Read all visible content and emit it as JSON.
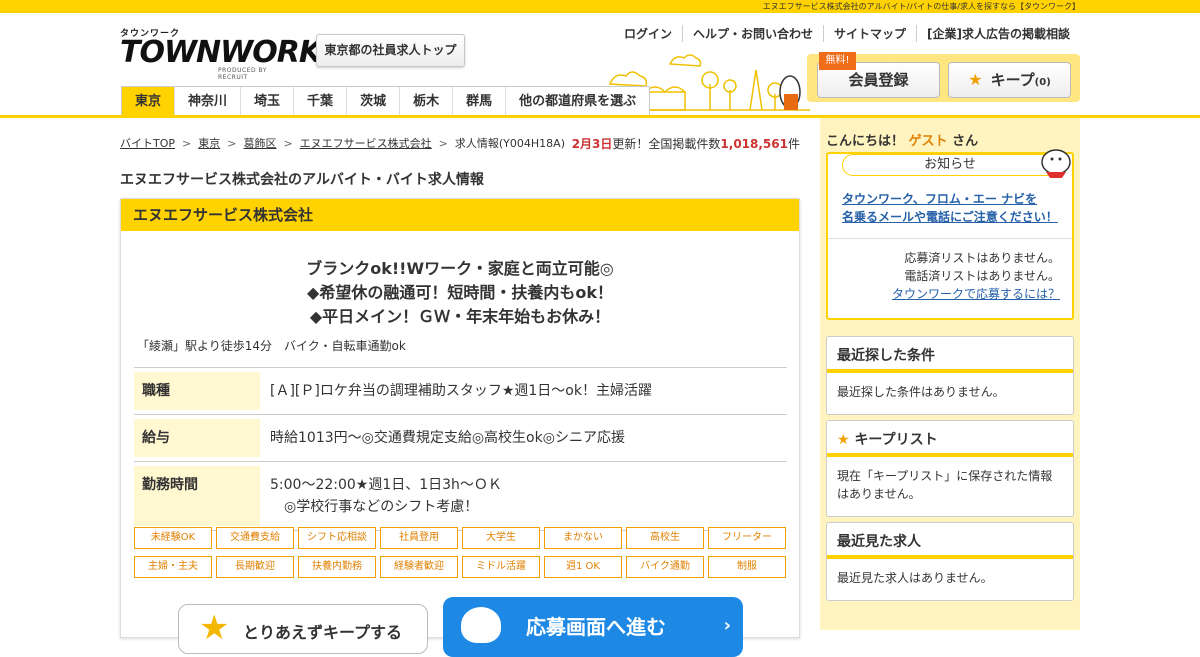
{
  "topbar": {
    "text": "エヌエフサービス株式会社のアルバイト/バイトの仕事/求人を探すなら【タウンワーク】"
  },
  "logo": {
    "kana": "タウンワーク",
    "word": "TOWNWORK",
    "produced": "PRODUCED BY RECRUIT"
  },
  "header": {
    "region_top": "東京都の社員求人トップ",
    "links": [
      "ログイン",
      "ヘルプ・お問い合わせ",
      "サイトマップ",
      "[企業]求人広告の掲載相談"
    ],
    "free_badge": "無料!",
    "register": "会員登録",
    "keep": "キープ",
    "keep_count": "(0)"
  },
  "prefectures": [
    "東京",
    "神奈川",
    "埼玉",
    "千葉",
    "茨城",
    "栃木",
    "群馬",
    "他の都道府県を選ぶ"
  ],
  "breadcrumb": [
    "バイトTOP",
    "東京",
    "葛飾区",
    "エヌエフサービス株式会社",
    "求人情報(Y004H18A)"
  ],
  "update": {
    "date": "2月3日",
    "mid": "更新！全国掲載件数",
    "count": "1,018,561",
    "unit": "件"
  },
  "page_title": "エヌエフサービス株式会社のアルバイト・バイト求人情報",
  "job": {
    "company": "エヌエフサービス株式会社",
    "catch": [
      "ブランクok!!Wワーク・家庭と両立可能◎",
      "◆希望休の融通可！短時間・扶養内もok！",
      "◆平日メイン！ＧＷ・年末年始もお休み！"
    ],
    "station": "「綾瀬」駅より徒歩14分　バイク・自転車通勤ok",
    "rows": [
      {
        "key": "職種",
        "value": "[Ａ][Ｐ]ロケ弁当の調理補助スタッフ★週1日～ok！主婦活躍"
      },
      {
        "key": "給与",
        "value": "時給1013円～◎交通費規定支給◎高校生ok◎シニア応援"
      },
      {
        "key": "勤務時間",
        "value": "5:00～22:00★週1日、1日3h～ＯＫ",
        "value2": "◎学校行事などのシフト考慮！"
      }
    ],
    "tags": [
      "未経験OK",
      "交通費支給",
      "シフト応相談",
      "社員登用",
      "大学生",
      "まかない",
      "高校生",
      "フリーター",
      "主婦・主夫",
      "長期歓迎",
      "扶養内勤務",
      "経験者歓迎",
      "ミドル活躍",
      "週1 OK",
      "バイク通勤",
      "制服"
    ],
    "keep_button": "とりあえずキープする",
    "apply_button": "応募画面へ進む"
  },
  "sidebar": {
    "greet_prefix": "こんにちは！",
    "guest": "ゲスト",
    "greet_suffix": "さん",
    "notice_title": "お知らせ",
    "notice_link_1": "タウンワーク、フロム・エー ナビを",
    "notice_link_2": "名乗るメールや電話にご注意ください！",
    "applied_list": "応募済リストはありません。",
    "called_list": "電話済リストはありません。",
    "howto": "タウンワークで応募するには？",
    "recent_search_title": "最近探した条件",
    "recent_search_body": "最近探した条件はありません。",
    "keep_list_title": "キープリスト",
    "keep_list_body": "現在「キープリスト」に保存された情報はありません。",
    "recent_viewed_title": "最近見た求人",
    "recent_viewed_body": "最近見た求人はありません。"
  },
  "colors": {
    "brand_yellow": "#ffd200",
    "accent_orange": "#e08000",
    "apply_blue": "#1e88e5",
    "update_red": "#cc3333"
  }
}
